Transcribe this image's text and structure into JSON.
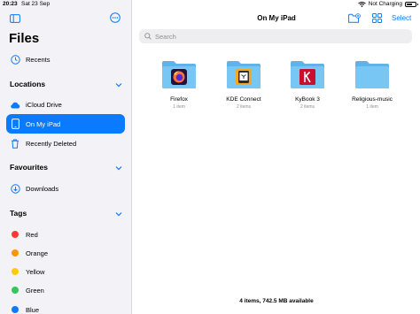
{
  "status_bar": {
    "time": "20:23",
    "date": "Sat 23 Sep",
    "battery_text": "Not Charging"
  },
  "sidebar": {
    "title": "Files",
    "recents": "Recents",
    "locations_header": "Locations",
    "locations": [
      {
        "label": "iCloud Drive",
        "icon": "cloud-icon"
      },
      {
        "label": "On My iPad",
        "icon": "ipad-icon",
        "selected": true
      },
      {
        "label": "Recently Deleted",
        "icon": "trash-icon"
      }
    ],
    "favourites_header": "Favourites",
    "favourites": [
      {
        "label": "Downloads",
        "icon": "download-icon"
      }
    ],
    "tags_header": "Tags",
    "tags": [
      {
        "label": "Red",
        "color": "#ff3b30"
      },
      {
        "label": "Orange",
        "color": "#ff9500"
      },
      {
        "label": "Yellow",
        "color": "#ffcc00"
      },
      {
        "label": "Green",
        "color": "#34c759"
      },
      {
        "label": "Blue",
        "color": "#0a7aff"
      }
    ]
  },
  "main": {
    "title": "On My iPad",
    "select_label": "Select",
    "search_placeholder": "Search",
    "folders": [
      {
        "name": "Firefox",
        "count": "1 item",
        "icon": "firefox-icon"
      },
      {
        "name": "KDE Connect",
        "count": "2 items",
        "icon": "kde-connect-icon"
      },
      {
        "name": "KyBook 3",
        "count": "2 items",
        "icon": "kybook-icon"
      },
      {
        "name": "Religious-music",
        "count": "1 item",
        "icon": ""
      }
    ],
    "footer": "4 items, 742.5 MB available"
  },
  "colors": {
    "accent": "#0a7aff",
    "folder": "#6cc0f0",
    "sidebar_bg": "#f2f2f7"
  }
}
